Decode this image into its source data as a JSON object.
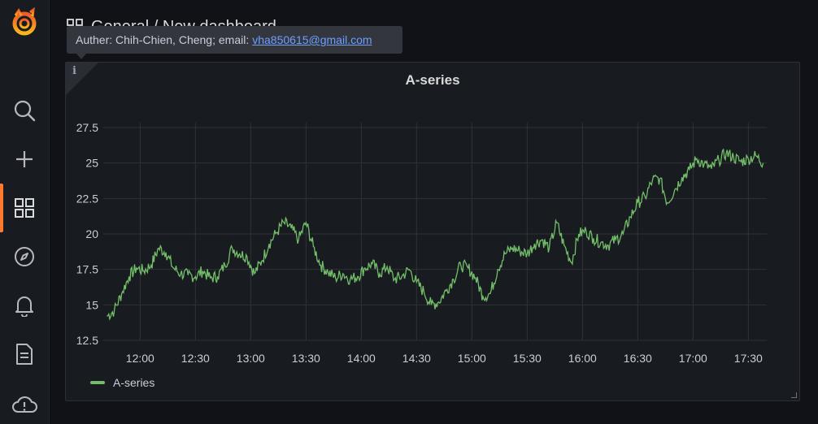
{
  "header": {
    "breadcrumb": "General / New dashboard"
  },
  "tooltip": {
    "text": "Auther: Chih-Chien, Cheng; email:",
    "email": "vha850615@gmail.com"
  },
  "panel": {
    "title": "A-series",
    "info_icon": "i"
  },
  "legend": {
    "label": "A-series",
    "color": "#73bf69"
  },
  "sidebar": {
    "icons": [
      "grafana-logo-icon",
      "search-icon",
      "plus-icon",
      "dashboards-icon",
      "explore-compass-icon",
      "alert-bell-icon",
      "document-icon",
      "cloud-alert-icon"
    ]
  },
  "chart_data": {
    "type": "line",
    "title": "A-series",
    "xlabel": "",
    "ylabel": "",
    "ylim": [
      12.5,
      27.5
    ],
    "yticks": [
      12.5,
      15,
      17.5,
      20,
      22.5,
      25,
      27.5
    ],
    "ytick_labels": [
      "12.5",
      "15",
      "17.5",
      "20",
      "22.5",
      "25",
      "27.5"
    ],
    "xlim_minutes": [
      "11:40",
      "17:40"
    ],
    "xtick_labels": [
      "12:00",
      "12:30",
      "13:00",
      "13:30",
      "14:00",
      "14:30",
      "15:00",
      "15:30",
      "16:00",
      "16:30",
      "17:00",
      "17:30"
    ],
    "grid": true,
    "legend_position": "bottom-left",
    "series": [
      {
        "name": "A-series",
        "color": "#73bf69",
        "x": [
          "11:42",
          "11:46",
          "11:50",
          "11:54",
          "11:58",
          "12:02",
          "12:06",
          "12:10",
          "12:14",
          "12:18",
          "12:22",
          "12:26",
          "12:30",
          "12:34",
          "12:38",
          "12:42",
          "12:46",
          "12:50",
          "12:54",
          "12:58",
          "13:02",
          "13:06",
          "13:10",
          "13:14",
          "13:18",
          "13:22",
          "13:26",
          "13:30",
          "13:34",
          "13:38",
          "13:42",
          "13:46",
          "13:50",
          "13:54",
          "13:58",
          "14:02",
          "14:06",
          "14:10",
          "14:14",
          "14:18",
          "14:22",
          "14:26",
          "14:30",
          "14:34",
          "14:38",
          "14:42",
          "14:46",
          "14:50",
          "14:54",
          "14:58",
          "15:02",
          "15:06",
          "15:10",
          "15:14",
          "15:18",
          "15:22",
          "15:26",
          "15:30",
          "15:34",
          "15:38",
          "15:42",
          "15:46",
          "15:50",
          "15:54",
          "15:58",
          "16:02",
          "16:06",
          "16:10",
          "16:14",
          "16:18",
          "16:22",
          "16:26",
          "16:30",
          "16:34",
          "16:38",
          "16:42",
          "16:46",
          "16:50",
          "16:54",
          "16:58",
          "17:02",
          "17:06",
          "17:10",
          "17:14",
          "17:18",
          "17:22",
          "17:26",
          "17:30",
          "17:34",
          "17:38"
        ],
        "values": [
          14.2,
          14.6,
          15.8,
          17.0,
          17.6,
          17.4,
          17.8,
          19.0,
          18.7,
          17.6,
          17.2,
          17.1,
          17.0,
          17.4,
          16.9,
          17.0,
          17.8,
          19.0,
          18.6,
          18.4,
          17.2,
          18.1,
          19.3,
          20.1,
          20.8,
          20.4,
          19.6,
          20.8,
          19.1,
          17.8,
          17.3,
          16.9,
          17.2,
          16.8,
          17.0,
          17.6,
          17.9,
          17.2,
          17.7,
          16.8,
          17.0,
          17.5,
          16.6,
          15.9,
          15.0,
          15.2,
          16.0,
          16.8,
          17.8,
          17.6,
          16.9,
          15.6,
          15.8,
          17.5,
          18.6,
          19.0,
          18.8,
          18.6,
          19.3,
          19.6,
          19.0,
          20.8,
          19.2,
          18.0,
          20.0,
          20.2,
          19.7,
          19.4,
          19.2,
          19.6,
          20.0,
          21.2,
          22.2,
          22.6,
          23.8,
          23.9,
          22.2,
          23.1,
          24.0,
          24.5,
          25.3,
          24.9,
          24.6,
          25.2,
          25.7,
          25.4,
          25.1,
          25.3,
          25.5,
          25.0
        ]
      }
    ]
  }
}
